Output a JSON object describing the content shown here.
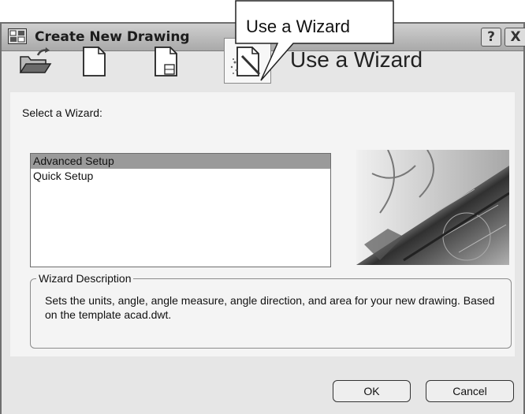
{
  "window": {
    "title": "Create New Drawing",
    "help_label": "?",
    "close_label": "X"
  },
  "callout": {
    "text": "Use a Wizard"
  },
  "toolbar": {
    "buttons": [
      {
        "icon": "open-folder-icon"
      },
      {
        "icon": "blank-page-icon"
      },
      {
        "icon": "template-page-icon"
      },
      {
        "icon": "wizard-page-icon",
        "selected": true
      }
    ],
    "mode_heading": "Use a Wizard"
  },
  "wizard": {
    "select_label": "Select a Wizard:",
    "items": [
      {
        "label": "Advanced Setup",
        "selected": true
      },
      {
        "label": "Quick Setup",
        "selected": false
      }
    ]
  },
  "description": {
    "legend": "Wizard Description",
    "text": "Sets the units, angle, angle measure, angle direction, and area for your new drawing. Based on the template acad.dwt."
  },
  "buttons": {
    "ok": "OK",
    "cancel": "Cancel"
  },
  "colors": {
    "dialog_bg": "#e6e6e6",
    "panel_bg": "#f4f4f4",
    "selection": "#9a9a9a"
  }
}
